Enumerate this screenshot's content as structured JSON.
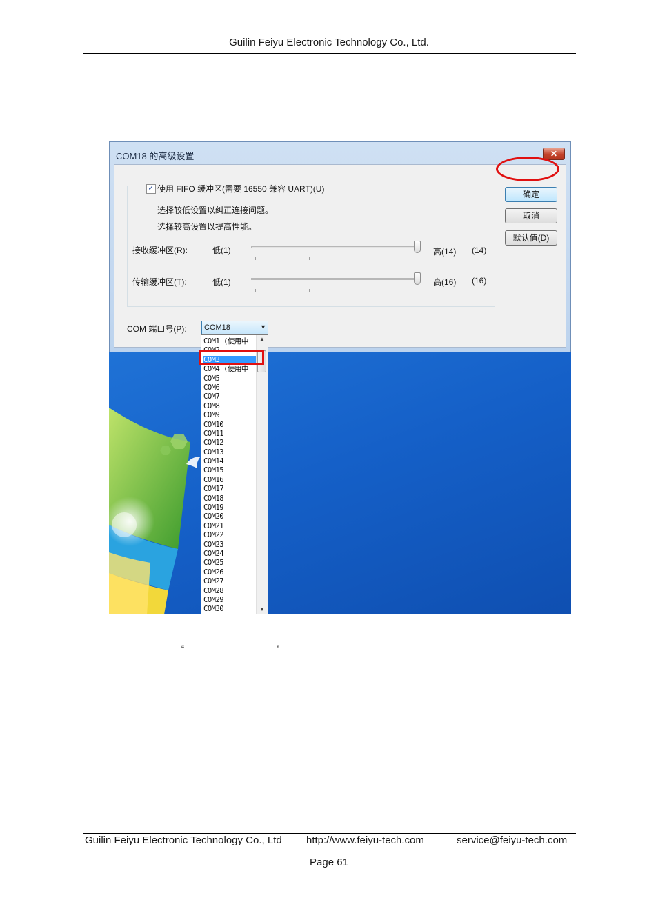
{
  "header": {
    "company": "Guilin Feiyu Electronic Technology Co., Ltd."
  },
  "dialog": {
    "title": "COM18 的高级设置",
    "close_glyph": "✕",
    "fifo_label": "使用 FIFO 缓冲区(需要 16550 兼容 UART)(U)",
    "fifo_checked": true,
    "hint_low": "选择较低设置以纠正连接问题。",
    "hint_high": "选择较高设置以提高性能。",
    "receive": {
      "label": "接收缓冲区(R):",
      "low": "低(1)",
      "high": "高(14)",
      "value": "(14)",
      "level": 1.0
    },
    "transmit": {
      "label": "传输缓冲区(T):",
      "low": "低(1)",
      "high": "高(16)",
      "value": "(16)",
      "level": 1.0
    },
    "buttons": {
      "ok": "确定",
      "cancel": "取消",
      "defaults": "默认值(D)"
    },
    "com_label": "COM 端口号(P):",
    "com_value": "COM18",
    "com_options": [
      "COM1 (使用中",
      "COM2",
      "COM3",
      "COM4 (使用中",
      "COM5",
      "COM6",
      "COM7",
      "COM8",
      "COM9",
      "COM10",
      "COM11",
      "COM12",
      "COM13",
      "COM14",
      "COM15",
      "COM16",
      "COM17",
      "COM18",
      "COM19",
      "COM20",
      "COM21",
      "COM22",
      "COM23",
      "COM24",
      "COM25",
      "COM26",
      "COM27",
      "COM28",
      "COM29",
      "COM30"
    ],
    "selected_option": "COM3"
  },
  "body": {
    "open_quote": "“",
    "close_quote": "”"
  },
  "footer": {
    "company": "Guilin Feiyu Electronic Technology Co., Ltd",
    "url": "http://www.feiyu-tech.com",
    "email": "service@feiyu-tech.com",
    "page": "Page 61"
  }
}
